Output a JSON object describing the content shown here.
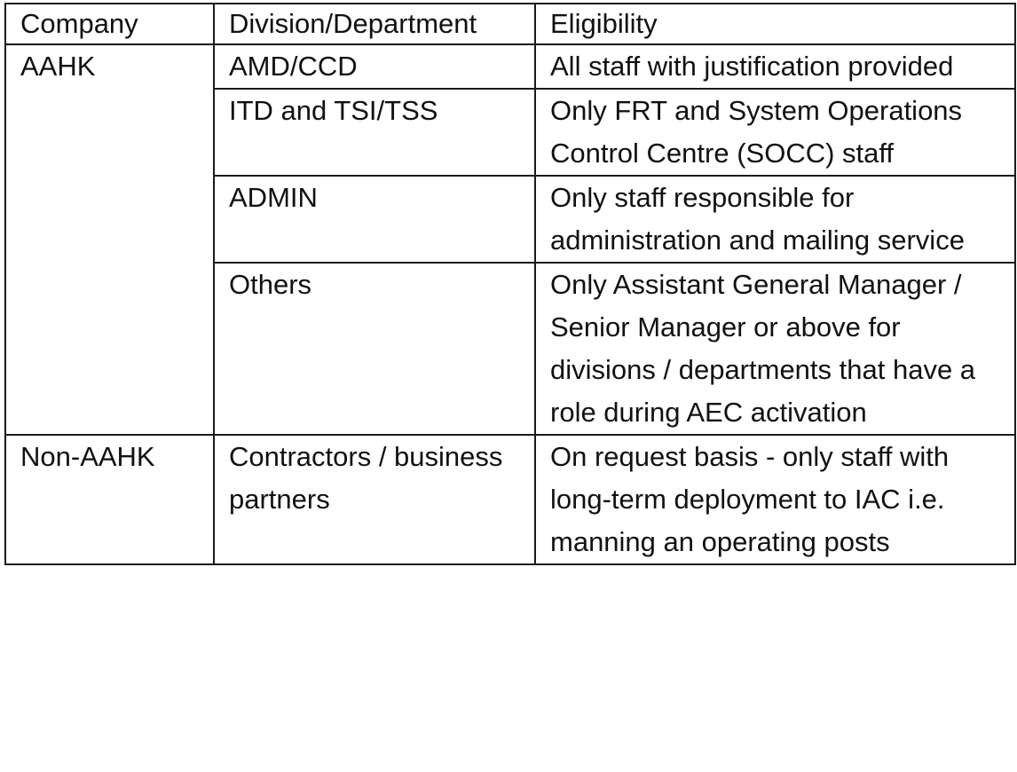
{
  "table": {
    "headers": [
      "Company",
      "Division/Department",
      "Eligibility"
    ],
    "groups": [
      {
        "company": "AAHK",
        "rows": [
          {
            "division": "AMD/CCD",
            "eligibility": "All staff with justification provided"
          },
          {
            "division": "ITD and TSI/TSS",
            "eligibility": "Only FRT and System Operations Control Centre (SOCC) staff"
          },
          {
            "division": "ADMIN",
            "eligibility": "Only staff responsible for administration and mailing service"
          },
          {
            "division": "Others",
            "eligibility": "Only Assistant General Manager / Senior Manager or above for divisions / departments that have a role during AEC activation"
          }
        ]
      },
      {
        "company": "Non-AAHK",
        "rows": [
          {
            "division": "Contractors / business partners",
            "eligibility": "On request basis - only staff with long-term deployment to IAC i.e. manning an operating posts"
          }
        ]
      }
    ]
  }
}
